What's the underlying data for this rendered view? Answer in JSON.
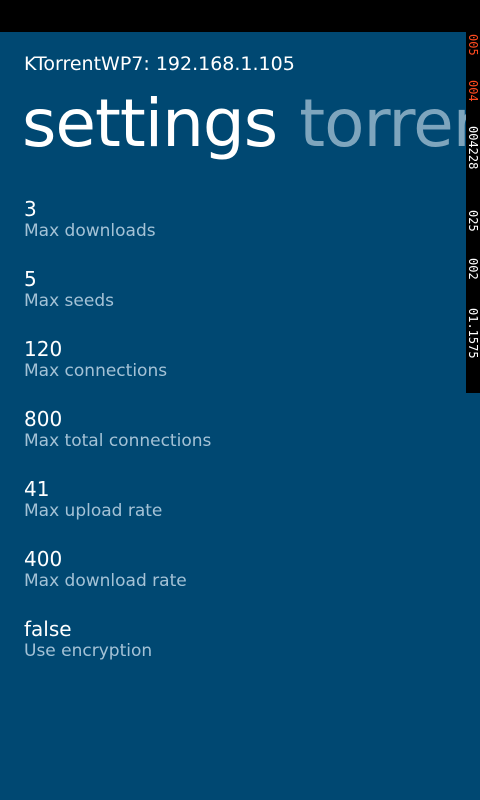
{
  "app": {
    "title": "KTorrentWP7: 192.168.1.105"
  },
  "pivot": {
    "headers": [
      {
        "label": "settings",
        "active": true
      },
      {
        "label": "torrents",
        "active": false
      }
    ]
  },
  "settings": [
    {
      "value": "3",
      "label": "Max downloads"
    },
    {
      "value": "5",
      "label": "Max seeds"
    },
    {
      "value": "120",
      "label": "Max connections"
    },
    {
      "value": "800",
      "label": "Max total connections"
    },
    {
      "value": "41",
      "label": "Max upload rate"
    },
    {
      "value": "400",
      "label": "Max download rate"
    },
    {
      "value": "false",
      "label": "Use encryption"
    }
  ],
  "debug_counters": [
    {
      "text": "005",
      "color": "#ff4a1f"
    },
    {
      "text": "004",
      "color": "#ff4a1f"
    },
    {
      "text": "004228",
      "color": "#ffffff"
    },
    {
      "text": "025",
      "color": "#ffffff"
    },
    {
      "text": "002",
      "color": "#ffffff"
    },
    {
      "text": "01.1575",
      "color": "#ffffff"
    }
  ]
}
